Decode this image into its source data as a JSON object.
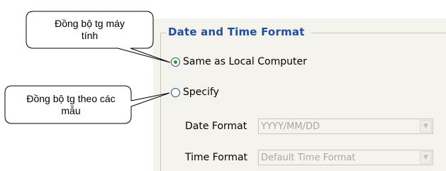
{
  "group": {
    "title": "Date and Time Format",
    "options": [
      {
        "label": "Same as Local Computer",
        "selected": true
      },
      {
        "label": "Specify",
        "selected": false
      }
    ]
  },
  "fields": {
    "date": {
      "label": "Date Format",
      "value": "YYYY/MM/DD",
      "enabled": false
    },
    "time": {
      "label": "Time Format",
      "value": "Default Time Format",
      "enabled": false
    }
  },
  "callouts": [
    {
      "text": "Đồng bộ tg máy tính"
    },
    {
      "text": "Đồng bộ tg theo các mẫu"
    }
  ],
  "colors": {
    "title": "#1f4fa5",
    "panel_bg": "#f4f3ee",
    "radio_dot": "#21a121",
    "disabled_text": "#a9a89d"
  },
  "icons": {
    "dropdown": "chevron-down-icon"
  }
}
